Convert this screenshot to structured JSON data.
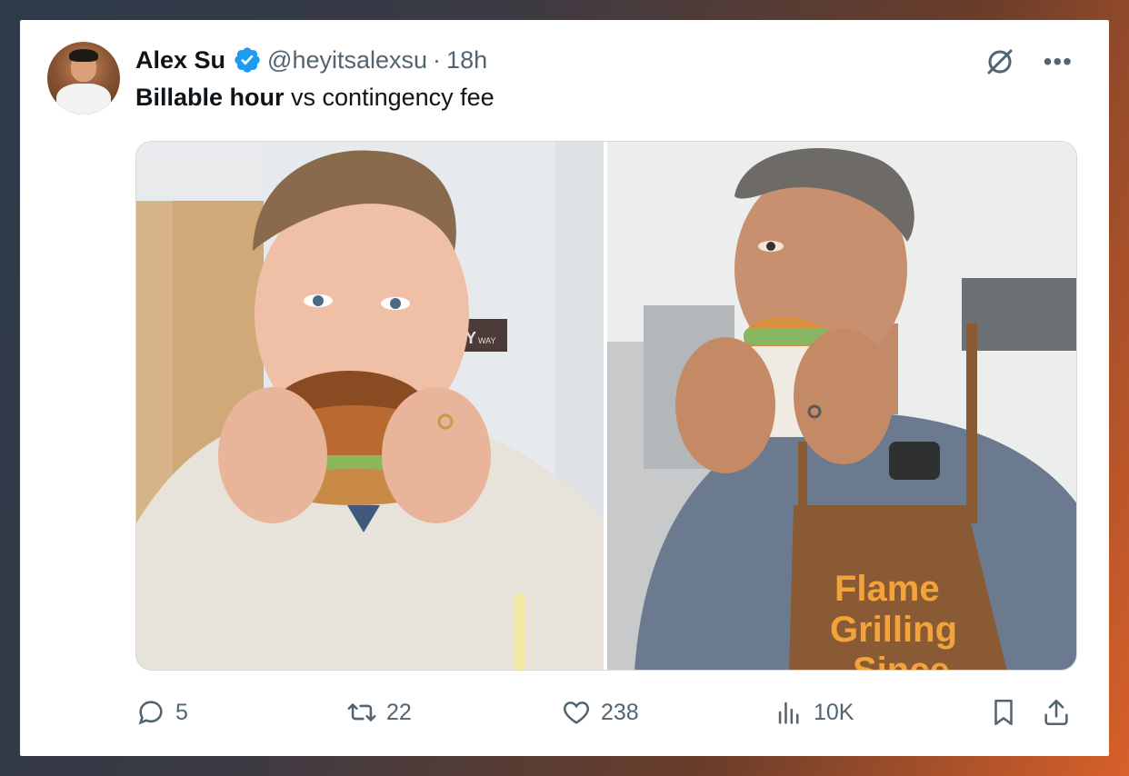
{
  "tweet": {
    "author_name": "Alex Su",
    "handle": "@heyitsalexsu",
    "separator": "·",
    "time": "18h",
    "text_bold": "Billable hour",
    "text_rest": " vs contingency fee"
  },
  "media": {
    "left_sign_text": "ETTY",
    "left_sign_sub": "WAY",
    "apron_line1": "Flame",
    "apron_line2": "Grilling",
    "apron_line3": "Since"
  },
  "actions": {
    "replies": "5",
    "reposts": "22",
    "likes": "238",
    "views": "10K"
  },
  "colors": {
    "verified": "#1d9bf0",
    "text_primary": "#0f1419",
    "text_secondary": "#536471"
  },
  "icons": [
    "verified-badge-icon",
    "grok-icon",
    "more-icon",
    "reply-icon",
    "repost-icon",
    "like-icon",
    "views-icon",
    "bookmark-icon",
    "share-icon"
  ]
}
